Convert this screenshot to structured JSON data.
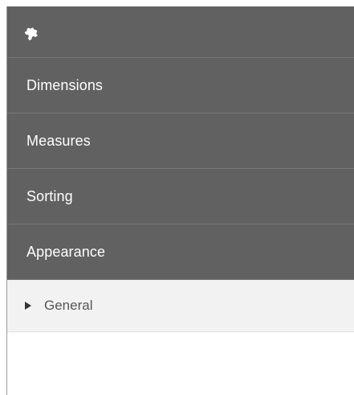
{
  "header": {
    "icon": "puzzle-piece-icon"
  },
  "sections": [
    {
      "label": "Dimensions"
    },
    {
      "label": "Measures"
    },
    {
      "label": "Sorting"
    },
    {
      "label": "Appearance"
    }
  ],
  "subsection": {
    "label": "General",
    "icon": "triangle-right-icon"
  },
  "colors": {
    "header_bg": "#616161",
    "section_bg": "#616161",
    "subsection_bg": "#f2f2f2",
    "section_text": "#ffffff",
    "subsection_text": "#555555"
  }
}
